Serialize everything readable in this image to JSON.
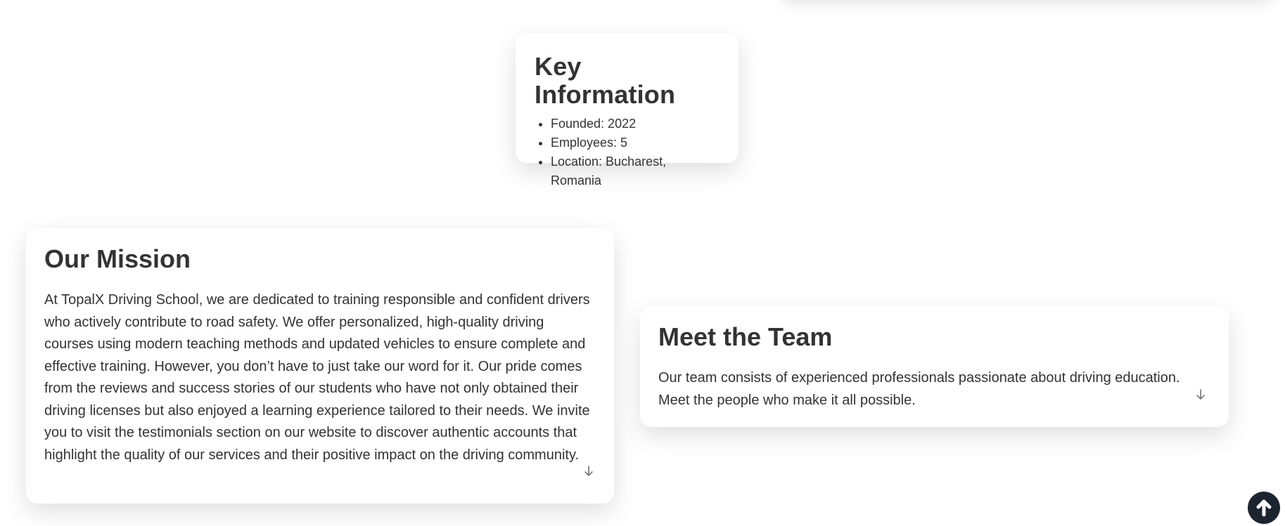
{
  "key_info": {
    "title": "Key Information",
    "items": [
      "Founded: 2022",
      "Employees: 5",
      "Location: Bucharest, Romania"
    ]
  },
  "mission": {
    "title": "Our Mission",
    "text": "At TopalX Driving School, we are dedicated to training responsible and confident drivers who actively contribute to road safety. We offer personalized, high-quality driving courses using modern teaching methods and updated vehicles to ensure complete and effective training. However, you don’t have to just take our word for it. Our pride comes from the reviews and success stories of our students who have not only obtained their driving licenses but also enjoyed a learning experience tailored to their needs. We invite you to visit the testimonials section on our website to discover authentic accounts that highlight the quality of our services and their positive impact on the driving community.",
    "expand_icon": "arrow-down-icon"
  },
  "team": {
    "title": "Meet the Team",
    "text": "Our team consists of experienced professionals passionate about driving education. Meet the people who make it all possible.",
    "expand_icon": "arrow-down-icon"
  },
  "scroll_top": {
    "icon": "arrow-up-icon"
  },
  "colors": {
    "text": "#333333",
    "card_background": "#ffffff",
    "scroll_button": "#1c2430"
  }
}
